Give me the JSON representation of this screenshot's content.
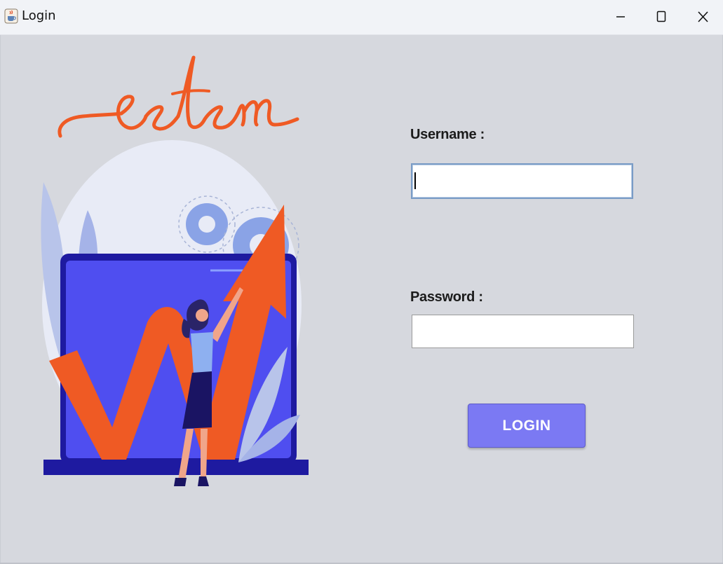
{
  "window": {
    "title": "Login",
    "icon": "java-coffee-cup-icon",
    "controls": [
      "minimize-icon",
      "maximize-icon",
      "close-icon"
    ]
  },
  "brand": {
    "logo_text": "estem",
    "logo_color": "#ef5a24"
  },
  "form": {
    "username_label": "Username :",
    "username_value": "",
    "password_label": "Password :",
    "password_value": "",
    "login_label": "LOGIN"
  },
  "colors": {
    "background": "#d6d8de",
    "button": "#7b79f3",
    "accent_orange": "#ef5a24",
    "laptop_screen": "#4f4ef0"
  }
}
